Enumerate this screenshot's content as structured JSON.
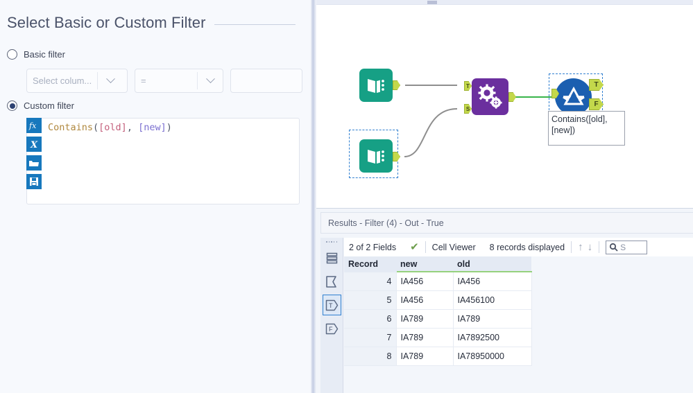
{
  "config": {
    "title": "Select Basic or Custom Filter",
    "basic": {
      "label": "Basic filter",
      "selected": false,
      "column_placeholder": "Select colum...",
      "operator_value": "=",
      "value_text": ""
    },
    "custom": {
      "label": "Custom filter",
      "selected": true,
      "formula": "Contains([old], [new])",
      "formula_tokens": {
        "fn": "Contains",
        "open": "(",
        "field1": "[old]",
        "comma": ", ",
        "field2": "[new]",
        "close": ")"
      },
      "gutter_icons": [
        {
          "name": "function-icon",
          "label": "fx"
        },
        {
          "name": "variable-icon",
          "label": "x"
        },
        {
          "name": "open-folder-icon",
          "label": "open"
        },
        {
          "name": "save-icon",
          "label": "save"
        }
      ]
    }
  },
  "canvas": {
    "nodes": [
      {
        "name": "text-input-1",
        "type": "book",
        "out_anchor": ""
      },
      {
        "name": "text-input-2",
        "type": "book",
        "out_anchor": "",
        "selected": true
      },
      {
        "name": "find-replace",
        "type": "gear",
        "in_anchor_1": "T",
        "in_anchor_2": "S",
        "out_anchor": ""
      },
      {
        "name": "filter",
        "type": "filter",
        "out_true": "T",
        "out_false": "F",
        "selected": true
      }
    ],
    "annotation": "Contains([old], [new])"
  },
  "results": {
    "title": "Results - Filter (4) - Out - True",
    "sidebar_buttons": [
      {
        "name": "records-view-icon",
        "label": "",
        "selected": false
      },
      {
        "name": "metadata-view-icon",
        "label": "",
        "selected": false
      },
      {
        "name": "true-output-icon",
        "label": "T",
        "selected": true
      },
      {
        "name": "false-output-icon",
        "label": "F",
        "selected": false
      }
    ],
    "toolbar": {
      "fields_label": "2 of 2 Fields",
      "viewer_label": "Cell Viewer",
      "records_label": "8 records displayed",
      "search_placeholder": "S",
      "check_glyph": "✔",
      "up_glyph": "↑",
      "down_glyph": "↓"
    },
    "table": {
      "columns": [
        "Record",
        "new",
        "old"
      ],
      "rows": [
        {
          "record": "4",
          "new": "IA456",
          "old": "IA456"
        },
        {
          "record": "5",
          "new": "IA456",
          "old": "IA456100"
        },
        {
          "record": "6",
          "new": "IA789",
          "old": "IA789"
        },
        {
          "record": "7",
          "new": "IA789",
          "old": "IA7892500"
        },
        {
          "record": "8",
          "new": "IA789",
          "old": "IA78950000"
        }
      ]
    }
  },
  "colors": {
    "panel_bg": "#f7f9fd",
    "accent_blue": "#1778bd",
    "node_teal": "#16a085",
    "node_purple": "#6b2f9e",
    "node_blue": "#1b5fb0",
    "anchor_green": "#c3d84b",
    "header_green": "#95d17d",
    "selection_blue": "#2f7fd0"
  }
}
